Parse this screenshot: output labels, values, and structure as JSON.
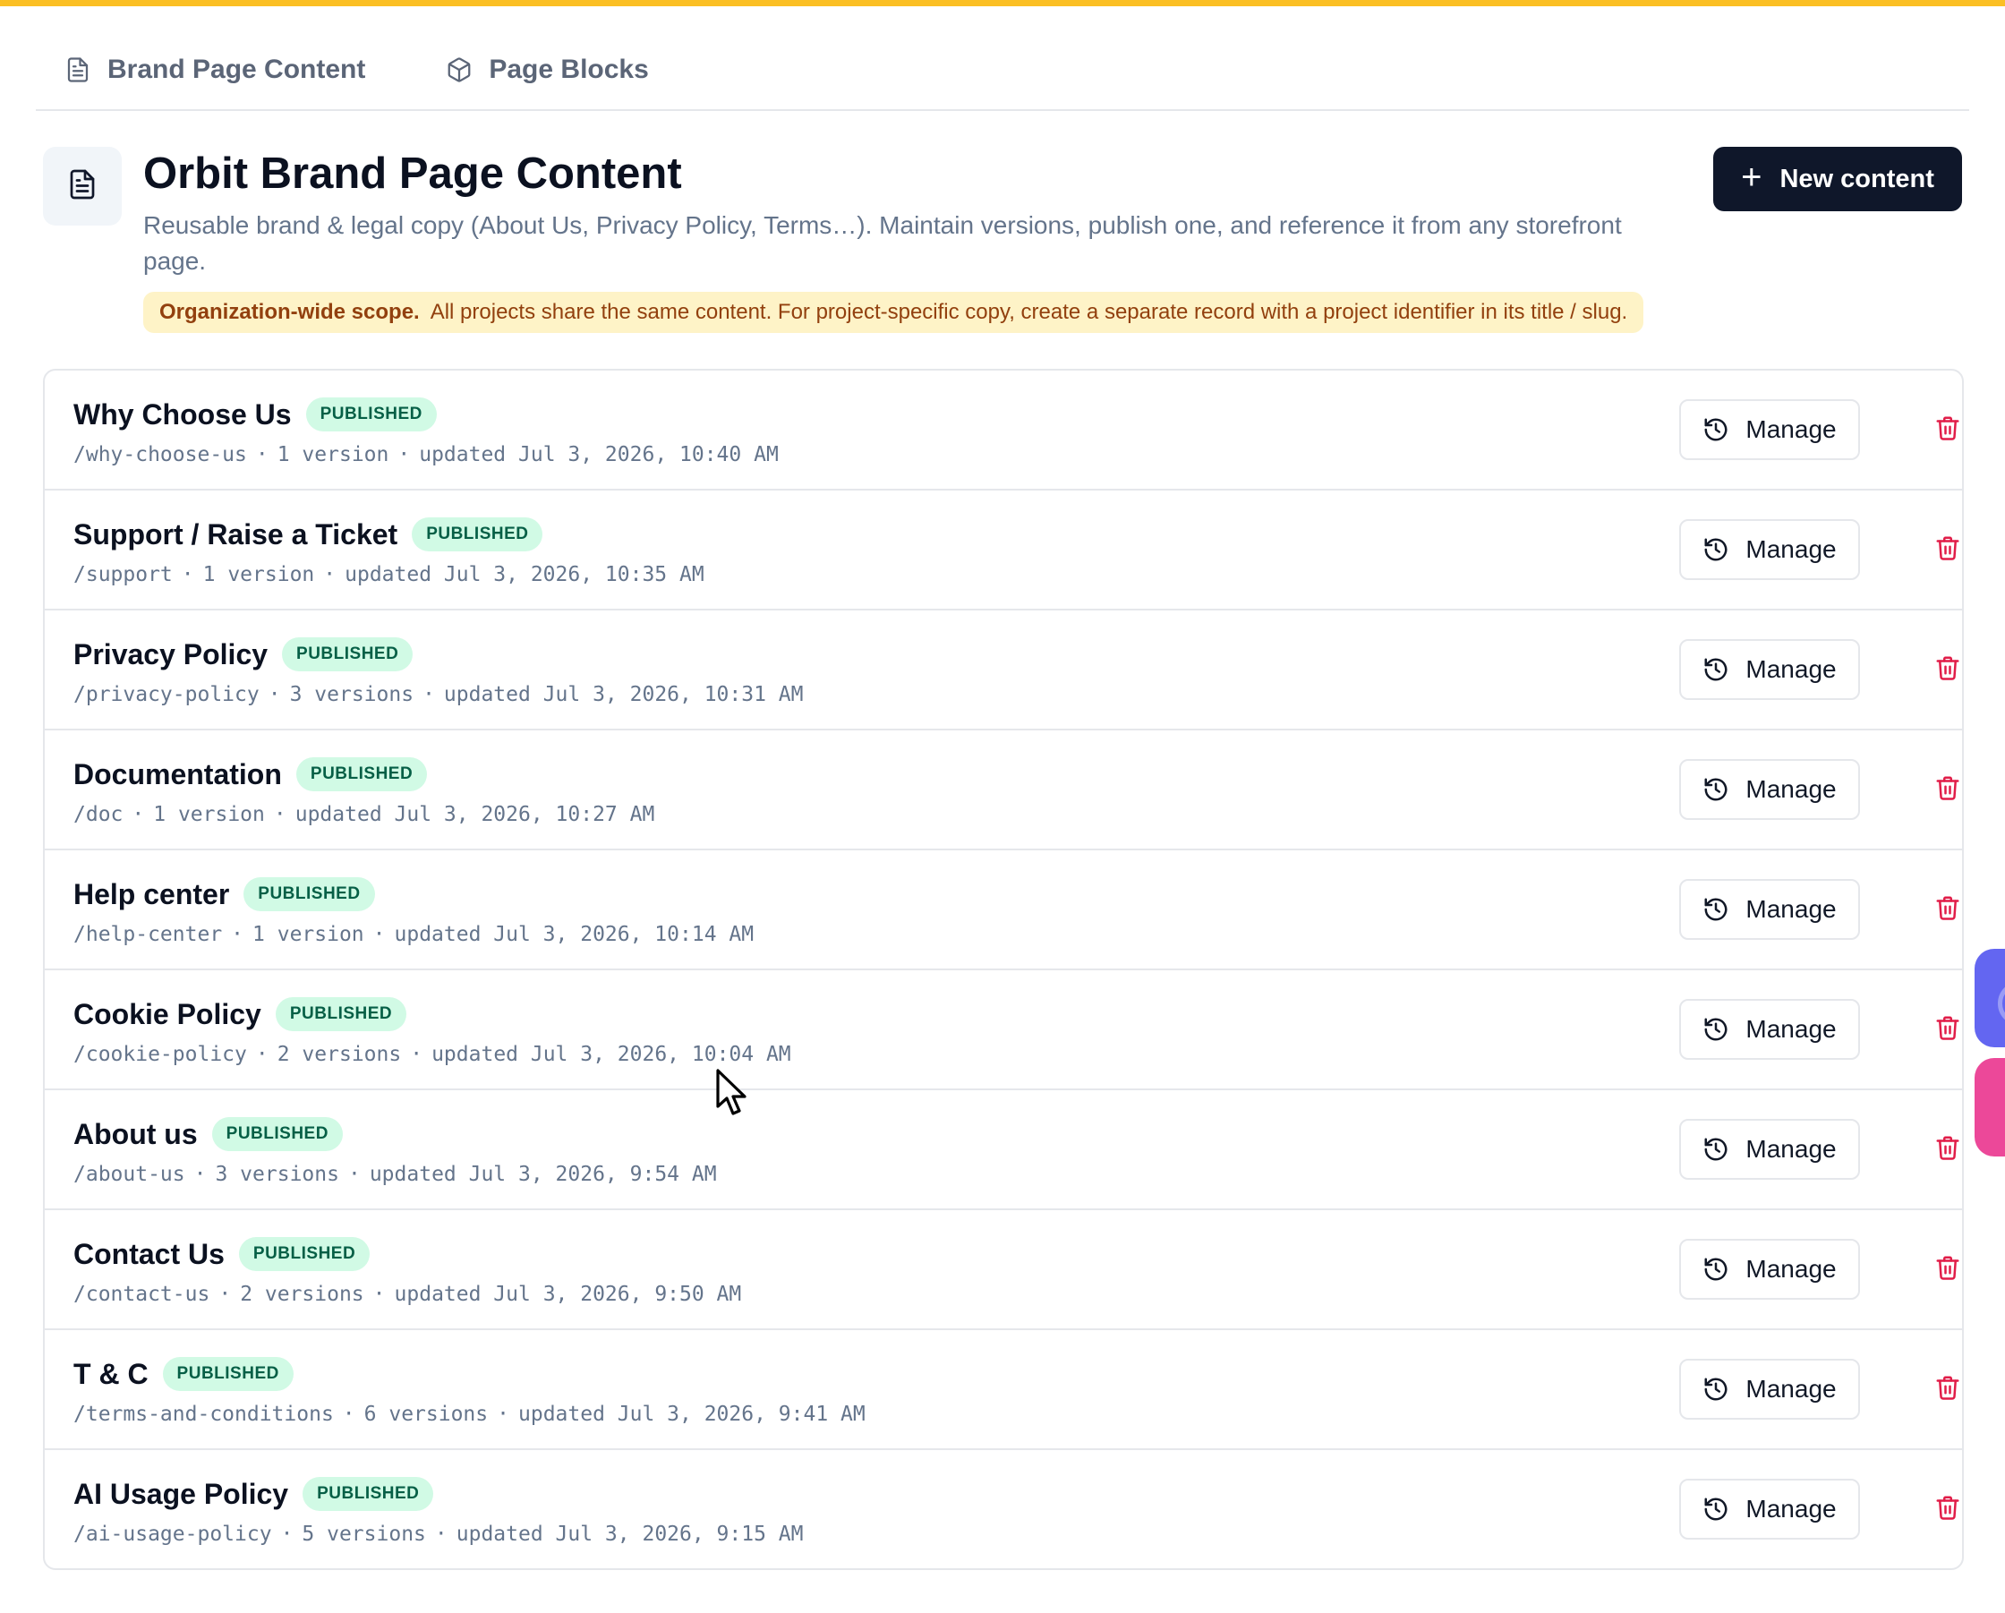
{
  "tabs": [
    {
      "label": "Brand Page Content",
      "icon": "document-icon"
    },
    {
      "label": "Page Blocks",
      "icon": "cube-icon"
    }
  ],
  "header": {
    "title": "Orbit Brand Page Content",
    "description": "Reusable brand & legal copy (About Us, Privacy Policy, Terms…). Maintain versions, publish one, and reference it from any storefront page.",
    "scope_strong": "Organization-wide scope.",
    "scope_text": "All projects share the same content. For project-specific copy, create a separate record with a project identifier in its title / slug.",
    "new_button_label": "New content"
  },
  "colors": {
    "accent_stripe": "#fbbf24",
    "primary_button": "#0f172a",
    "badge_bg": "#d1fae5",
    "badge_text": "#065f46",
    "delete": "#e11d48",
    "scope_bg": "#fef3c7"
  },
  "rows": [
    {
      "title": "Why Choose Us",
      "status": "PUBLISHED",
      "slug": "/why-choose-us",
      "versions": "1 version",
      "updated": "updated Jul 3, 2026, 10:40 AM",
      "manage_label": "Manage"
    },
    {
      "title": "Support / Raise a Ticket",
      "status": "PUBLISHED",
      "slug": "/support",
      "versions": "1 version",
      "updated": "updated Jul 3, 2026, 10:35 AM",
      "manage_label": "Manage"
    },
    {
      "title": "Privacy Policy",
      "status": "PUBLISHED",
      "slug": "/privacy-policy",
      "versions": "3 versions",
      "updated": "updated Jul 3, 2026, 10:31 AM",
      "manage_label": "Manage"
    },
    {
      "title": "Documentation",
      "status": "PUBLISHED",
      "slug": "/doc",
      "versions": "1 version",
      "updated": "updated Jul 3, 2026, 10:27 AM",
      "manage_label": "Manage"
    },
    {
      "title": "Help center",
      "status": "PUBLISHED",
      "slug": "/help-center",
      "versions": "1 version",
      "updated": "updated Jul 3, 2026, 10:14 AM",
      "manage_label": "Manage"
    },
    {
      "title": "Cookie Policy",
      "status": "PUBLISHED",
      "slug": "/cookie-policy",
      "versions": "2 versions",
      "updated": "updated Jul 3, 2026, 10:04 AM",
      "manage_label": "Manage"
    },
    {
      "title": "About us",
      "status": "PUBLISHED",
      "slug": "/about-us",
      "versions": "3 versions",
      "updated": "updated Jul 3, 2026, 9:54 AM",
      "manage_label": "Manage"
    },
    {
      "title": "Contact Us",
      "status": "PUBLISHED",
      "slug": "/contact-us",
      "versions": "2 versions",
      "updated": "updated Jul 3, 2026, 9:50 AM",
      "manage_label": "Manage"
    },
    {
      "title": "T & C",
      "status": "PUBLISHED",
      "slug": "/terms-and-conditions",
      "versions": "6 versions",
      "updated": "updated Jul 3, 2026, 9:41 AM",
      "manage_label": "Manage"
    },
    {
      "title": "AI Usage Policy",
      "status": "PUBLISHED",
      "slug": "/ai-usage-policy",
      "versions": "5 versions",
      "updated": "updated Jul 3, 2026, 9:15 AM",
      "manage_label": "Manage"
    }
  ]
}
